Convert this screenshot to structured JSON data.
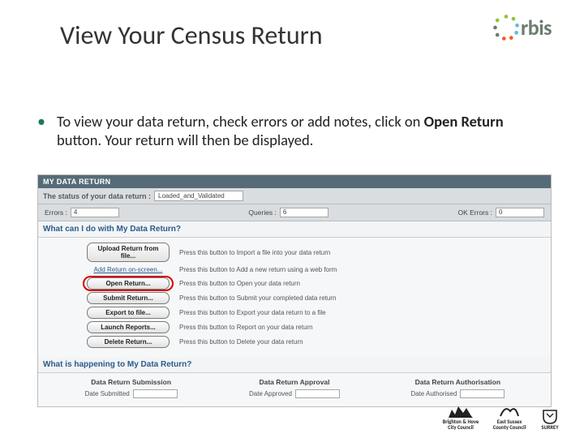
{
  "title": "View Your Census Return",
  "brand": {
    "name": "rbis"
  },
  "bullet": {
    "pre": "To view your data return, check errors or add notes, click on ",
    "bold": "Open Return",
    "post": " button. Your return will then be displayed."
  },
  "panel": {
    "header": "MY DATA RETURN",
    "status_label": "The status of your data return :",
    "status_value": "Loaded_and_Validated",
    "counts": {
      "errors_label": "Errors :",
      "errors_value": "4",
      "queries_label": "Queries :",
      "queries_value": "6",
      "ok_label": "OK Errors :",
      "ok_value": "0"
    },
    "section1": "What can I do with My Data Return?",
    "actions": [
      {
        "label": "Upload Return from file...",
        "desc": "Press this button to Import a file into your data return",
        "kind": "btn"
      },
      {
        "label": "Add Return on-screen...",
        "desc": "Press this button to Add a new return using a web form",
        "kind": "link"
      },
      {
        "label": "Open Return...",
        "desc": "Press this button to Open your data return",
        "kind": "btn",
        "highlight": true
      },
      {
        "label": "Submit Return...",
        "desc": "Press this button to Submit your completed data return",
        "kind": "btn"
      },
      {
        "label": "Export to file...",
        "desc": "Press this button to Export your data return to a file",
        "kind": "btn"
      },
      {
        "label": "Launch Reports...",
        "desc": "Press this button to Report on your data return",
        "kind": "btn"
      },
      {
        "label": "Delete Return...",
        "desc": "Press this button to Delete your data return",
        "kind": "btn"
      }
    ],
    "section2": "What is happening to My Data Return?",
    "submission": {
      "hdr": "Data Return Submission",
      "lbl": "Date Submitted"
    },
    "approval": {
      "hdr": "Data Return Approval",
      "lbl": "Date Approved"
    },
    "authorisation": {
      "hdr": "Data Return Authorisation",
      "lbl": "Date Authorised"
    }
  },
  "footer": {
    "logo1": "Brighton & Hove City Council",
    "logo2": "East Sussex County Council",
    "logo3": "SURREY"
  }
}
